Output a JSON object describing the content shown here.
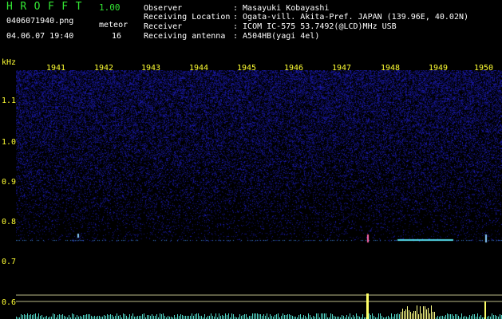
{
  "app": {
    "title": "HROFFT",
    "version": "1.00"
  },
  "file": {
    "name": "0406071940.png",
    "timestamp": "04.06.07 19:40"
  },
  "meteor": {
    "label": "meteor",
    "count": "16"
  },
  "info": [
    {
      "key": "Observer",
      "value": ": Masayuki Kobayashi"
    },
    {
      "key": "Receiving Location",
      "value": ": Ogata-vill. Akita-Pref. JAPAN (139.96E, 40.02N)"
    },
    {
      "key": "Receiver",
      "value": ": ICOM IC-575 53.7492(@LCD)MHz USB"
    },
    {
      "key": "Receiving antenna",
      "value": ": A504HB(yagi 4el)"
    }
  ],
  "axes": {
    "unit": "kHz",
    "y_ticks": [
      "1.1",
      "1.0",
      "0.9",
      "0.8",
      "0.7",
      "0.6"
    ],
    "x_ticks": [
      "1941",
      "1942",
      "1943",
      "1944",
      "1945",
      "1946",
      "1947",
      "1948",
      "1949",
      "1950"
    ]
  },
  "colors": {
    "title_green": "#33e633",
    "axis_yellow": "#ffff33",
    "text_white": "#ffffff",
    "background": "#000000",
    "spectrum_blue": "#1e1e8c",
    "echo_color": "#55ddee",
    "level_color": "#ffff88"
  }
}
